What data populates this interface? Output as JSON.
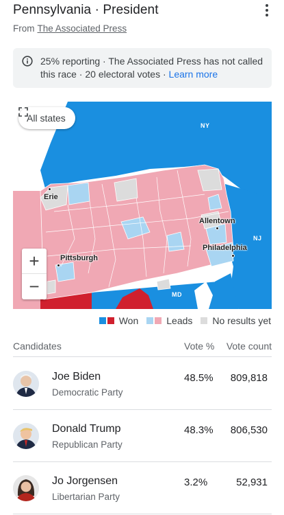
{
  "header": {
    "title": "Pennsylvania · President",
    "source_prefix": "From",
    "source_link": "The Associated Press"
  },
  "notice": {
    "text": "25% reporting · The Associated Press has not called this race · 20 electoral votes · ",
    "link": "Learn more"
  },
  "map": {
    "all_states": "All states",
    "zoom_in": "+",
    "zoom_out": "−",
    "labels": {
      "ny": "NY",
      "nj": "NJ",
      "md": "MD",
      "erie": "Erie",
      "allentown": "Allentown",
      "pittsburgh": "Pittsburgh",
      "philadelphia": "Philadelphia"
    },
    "colors": {
      "dem_won": "#1a8fe0",
      "rep_won": "#d0202e",
      "dem_leads": "#a9d5f2",
      "rep_leads": "#f0a8b4",
      "no_results": "#dcdcdc"
    }
  },
  "legend": {
    "won": "Won",
    "leads": "Leads",
    "no_results": "No results yet"
  },
  "table": {
    "headers": {
      "candidates": "Candidates",
      "vote_pct": "Vote %",
      "vote_count": "Vote count"
    },
    "rows": [
      {
        "name": "Joe Biden",
        "party": "Democratic Party",
        "pct": "48.5%",
        "count": "809,818"
      },
      {
        "name": "Donald Trump",
        "party": "Republican Party",
        "pct": "48.3%",
        "count": "806,530"
      },
      {
        "name": "Jo Jorgensen",
        "party": "Libertarian Party",
        "pct": "3.2%",
        "count": "52,931"
      }
    ]
  }
}
